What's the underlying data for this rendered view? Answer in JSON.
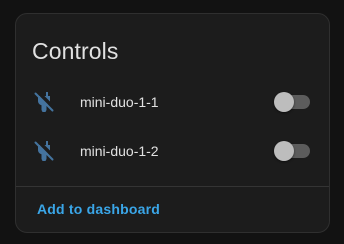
{
  "card": {
    "title": "Controls",
    "entities": [
      {
        "name": "mini-duo-1-1",
        "icon": "power-plug-off-icon",
        "state": "off"
      },
      {
        "name": "mini-duo-1-2",
        "icon": "power-plug-off-icon",
        "state": "off"
      }
    ],
    "footer_action": "Add to dashboard"
  },
  "colors": {
    "page_background": "#121212",
    "card_background": "#1c1c1c",
    "card_border": "#2f2f2f",
    "text_primary": "#e1e1e1",
    "icon_color": "#44739e",
    "toggle_track_off": "#5c5c5c",
    "toggle_thumb_off": "#bdbdbd",
    "accent_link": "#3aa6e8"
  }
}
